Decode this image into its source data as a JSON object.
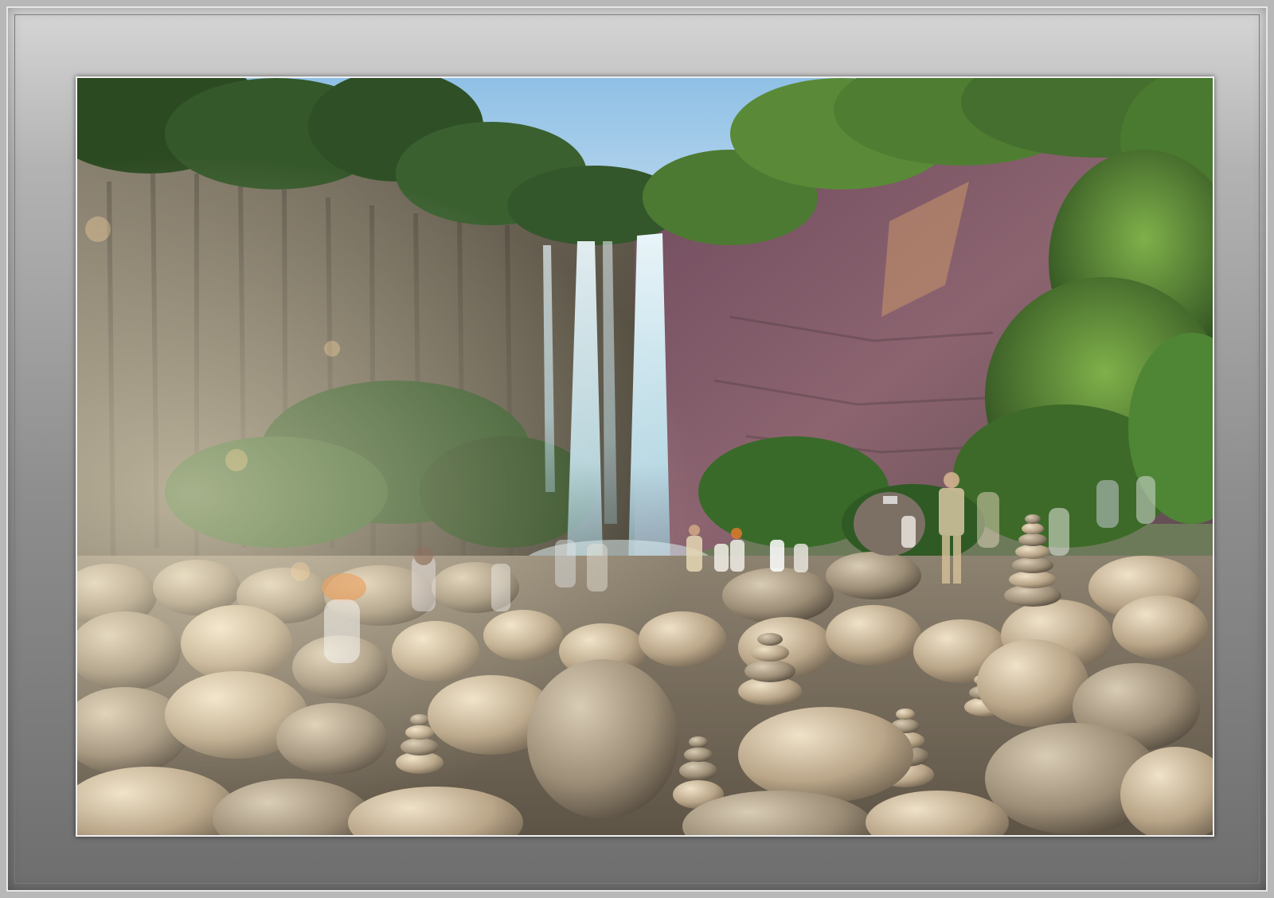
{
  "photo": {
    "subject": "waterfall",
    "colors": {
      "sky": "#a9cde8",
      "foliage": "#3f6a2c",
      "cliff": "#6e5a52",
      "cliff_pink": "#8a5a6a",
      "water": "#cfe6f0",
      "rocks": "#b8a48a",
      "mat": "#9a9a9a",
      "border": "#efefef"
    }
  }
}
